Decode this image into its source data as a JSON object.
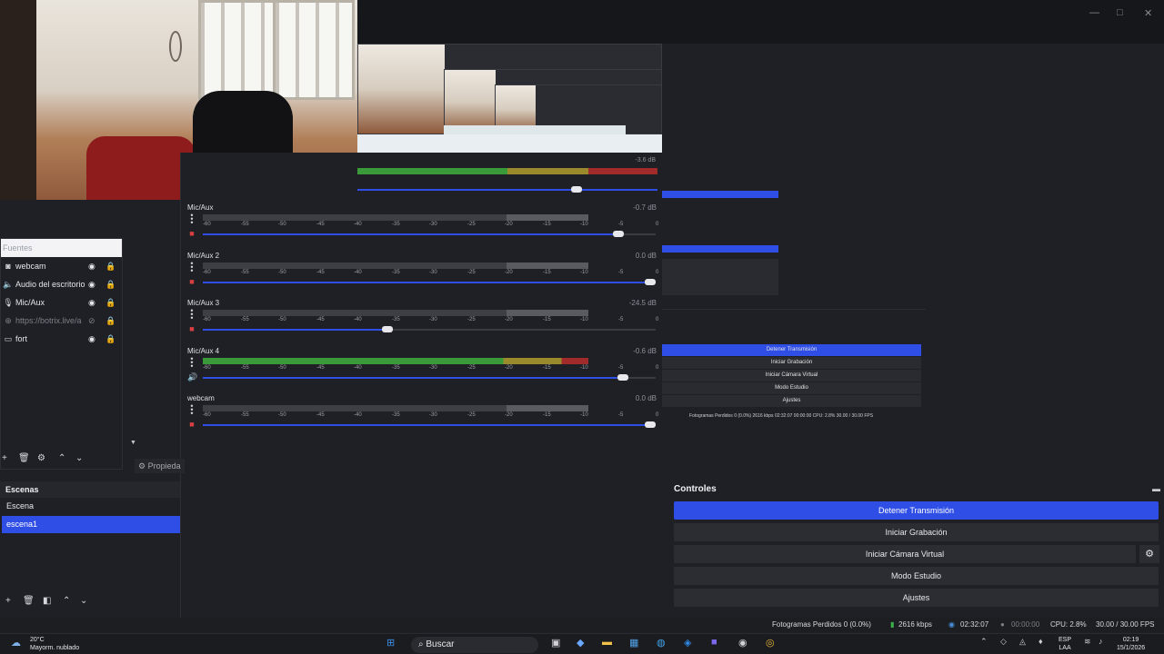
{
  "window": {
    "minimize": "—",
    "maximize": "□",
    "close": "✕"
  },
  "mixer": {
    "top_db": "-3.6 dB",
    "ticks": [
      "-60",
      "-55",
      "-50",
      "-45",
      "-40",
      "-35",
      "-30",
      "-25",
      "-20",
      "-15",
      "-10",
      "-5",
      "0"
    ],
    "channels": [
      {
        "name": "Mic/Aux",
        "db": "-0.7 dB",
        "level": 0.93,
        "active": false,
        "muted": true
      },
      {
        "name": "Mic/Aux 2",
        "db": "0.0 dB",
        "level": 1.0,
        "active": false,
        "muted": true
      },
      {
        "name": "Mic/Aux 3",
        "db": "-24.5 dB",
        "level": 0.42,
        "active": false,
        "muted": true
      },
      {
        "name": "Mic/Aux 4",
        "db": "-0.6 dB",
        "level": 0.94,
        "active": true,
        "muted": false
      },
      {
        "name": "webcam",
        "db": "0.0 dB",
        "level": 1.0,
        "active": false,
        "muted": true
      }
    ]
  },
  "sources": {
    "header": "Fuentes",
    "items": [
      {
        "label": "webcam",
        "icon": "camera-icon"
      },
      {
        "label": "Audio del escritorio",
        "icon": "speaker-icon"
      },
      {
        "label": "Mic/Aux",
        "icon": "microphone-icon"
      },
      {
        "label": "https://botrix.live/a",
        "icon": "globe-icon"
      },
      {
        "label": "fort",
        "icon": "display-icon"
      }
    ],
    "properties": "Propieda"
  },
  "scenes": {
    "title": "Escenas",
    "items": [
      {
        "label": "Escena",
        "selected": false
      },
      {
        "label": "escena1",
        "selected": true
      }
    ]
  },
  "controls": {
    "title": "Controles",
    "stop_stream": "Detener Transmisión",
    "start_recording": "Iniciar Grabación",
    "start_virtual_cam": "Iniciar Cámara Virtual",
    "studio_mode": "Modo Estudio",
    "settings": "Ajustes"
  },
  "mini_controls": {
    "stop_stream": "Detener Transmisión",
    "start_recording": "Iniciar Grabación",
    "start_virtual_cam": "Iniciar Cámara Virtual",
    "studio_mode": "Modo Estudio",
    "settings": "Ajustes",
    "status": "Fotogramas Perdidos 0 (0.0%)   2616 kbps   02:32:07   00:00:00   CPU: 2.8%   30.00 / 30.00 FPS"
  },
  "status": {
    "dropped": "Fotogramas Perdidos 0 (0.0%)",
    "bitrate": "2616 kbps",
    "stream_time": "02:32:07",
    "rec_time": "00:00:00",
    "cpu": "CPU: 2.8%",
    "fps": "30.00 / 30.00 FPS"
  },
  "taskbar": {
    "temp": "20°C",
    "weather": "Mayorm. nublado",
    "search": "Buscar",
    "lang1": "ESP",
    "lang2": "LAA",
    "time": "02:19",
    "date": "15/1/2026"
  }
}
